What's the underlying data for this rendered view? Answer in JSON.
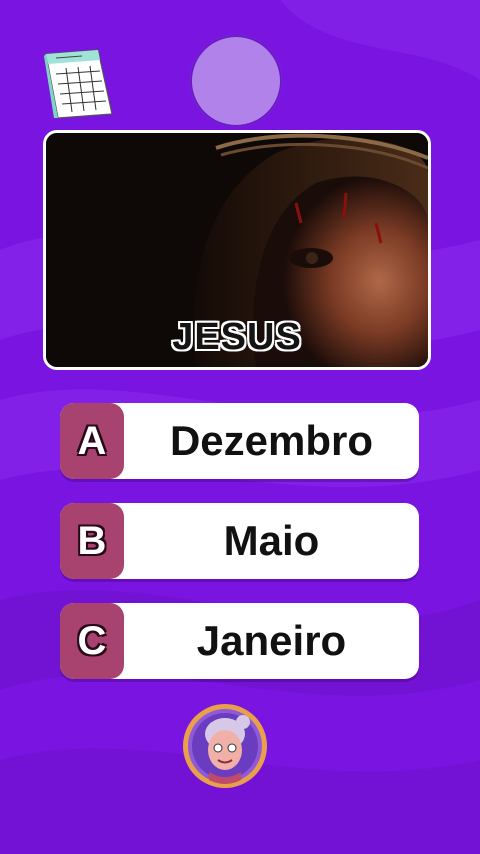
{
  "colors": {
    "background": "#7a14e0",
    "timer": "#b183ea",
    "letter_badge": "#a84370",
    "option_bg": "#ffffff",
    "avatar_ring": "#e8a04a"
  },
  "header": {
    "calendar_icon": "calendar-icon",
    "timer_icon": "timer-circle"
  },
  "question": {
    "image_caption": "JESUS"
  },
  "options": [
    {
      "letter": "A",
      "label": "Dezembro"
    },
    {
      "letter": "B",
      "label": "Maio"
    },
    {
      "letter": "C",
      "label": "Janeiro"
    }
  ],
  "footer": {
    "avatar_icon": "grandma-avatar-icon"
  }
}
